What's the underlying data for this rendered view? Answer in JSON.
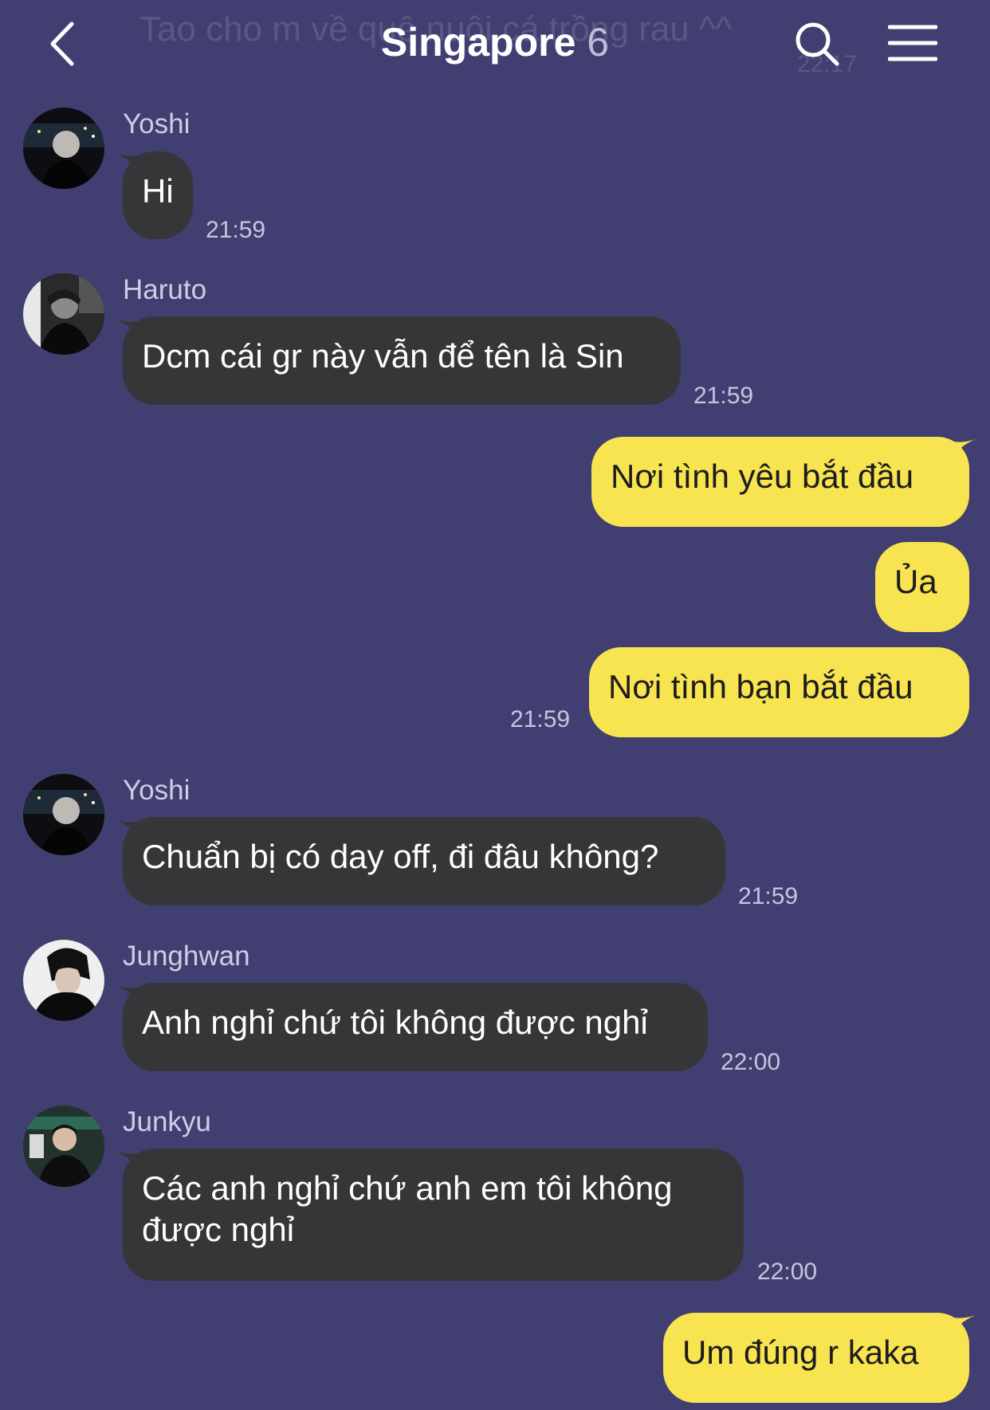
{
  "header": {
    "ghost_message": "Tao cho m về quê nuôi cá trồng rau ^^",
    "ghost_time": "22:17",
    "title": "Singapore",
    "member_count": "6"
  },
  "messages": [
    {
      "sender": "Yoshi",
      "text": "Hi",
      "time": "21:59"
    },
    {
      "sender": "Haruto",
      "text": "Dcm cái gr này vẫn để tên là Sin",
      "time": "21:59"
    },
    {
      "text": "Nơi tình yêu bắt đầu"
    },
    {
      "text": "Ủa"
    },
    {
      "text": "Nơi tình bạn bắt đầu",
      "time": "21:59"
    },
    {
      "sender": "Yoshi",
      "text": "Chuẩn bị có day off, đi đâu không?",
      "time": "21:59"
    },
    {
      "sender": "Junghwan",
      "text": "Anh nghỉ chứ tôi không được nghỉ",
      "time": "22:00"
    },
    {
      "sender": "Junkyu",
      "text_line1": "Các anh nghỉ chứ anh em tôi không",
      "text_line2": "được nghỉ",
      "time": "22:00"
    },
    {
      "text": "Um đúng r kaka"
    }
  ],
  "colors": {
    "background": "#413f71",
    "incoming_bubble": "#363638",
    "outgoing_bubble": "#f8e451"
  }
}
